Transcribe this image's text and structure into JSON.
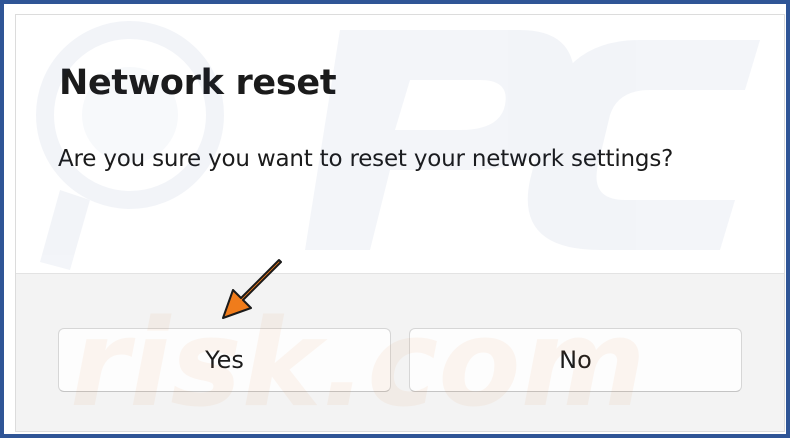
{
  "dialog": {
    "title": "Network reset",
    "message": "Are you sure you want to reset your network settings?",
    "buttons": {
      "yes_label": "Yes",
      "no_label": "No"
    }
  },
  "annotation": {
    "arrow_color": "#f07c1b",
    "frame_color": "#2f5596"
  },
  "watermark": {
    "brand_text": "PC",
    "brand_suffix": "risk.com"
  }
}
